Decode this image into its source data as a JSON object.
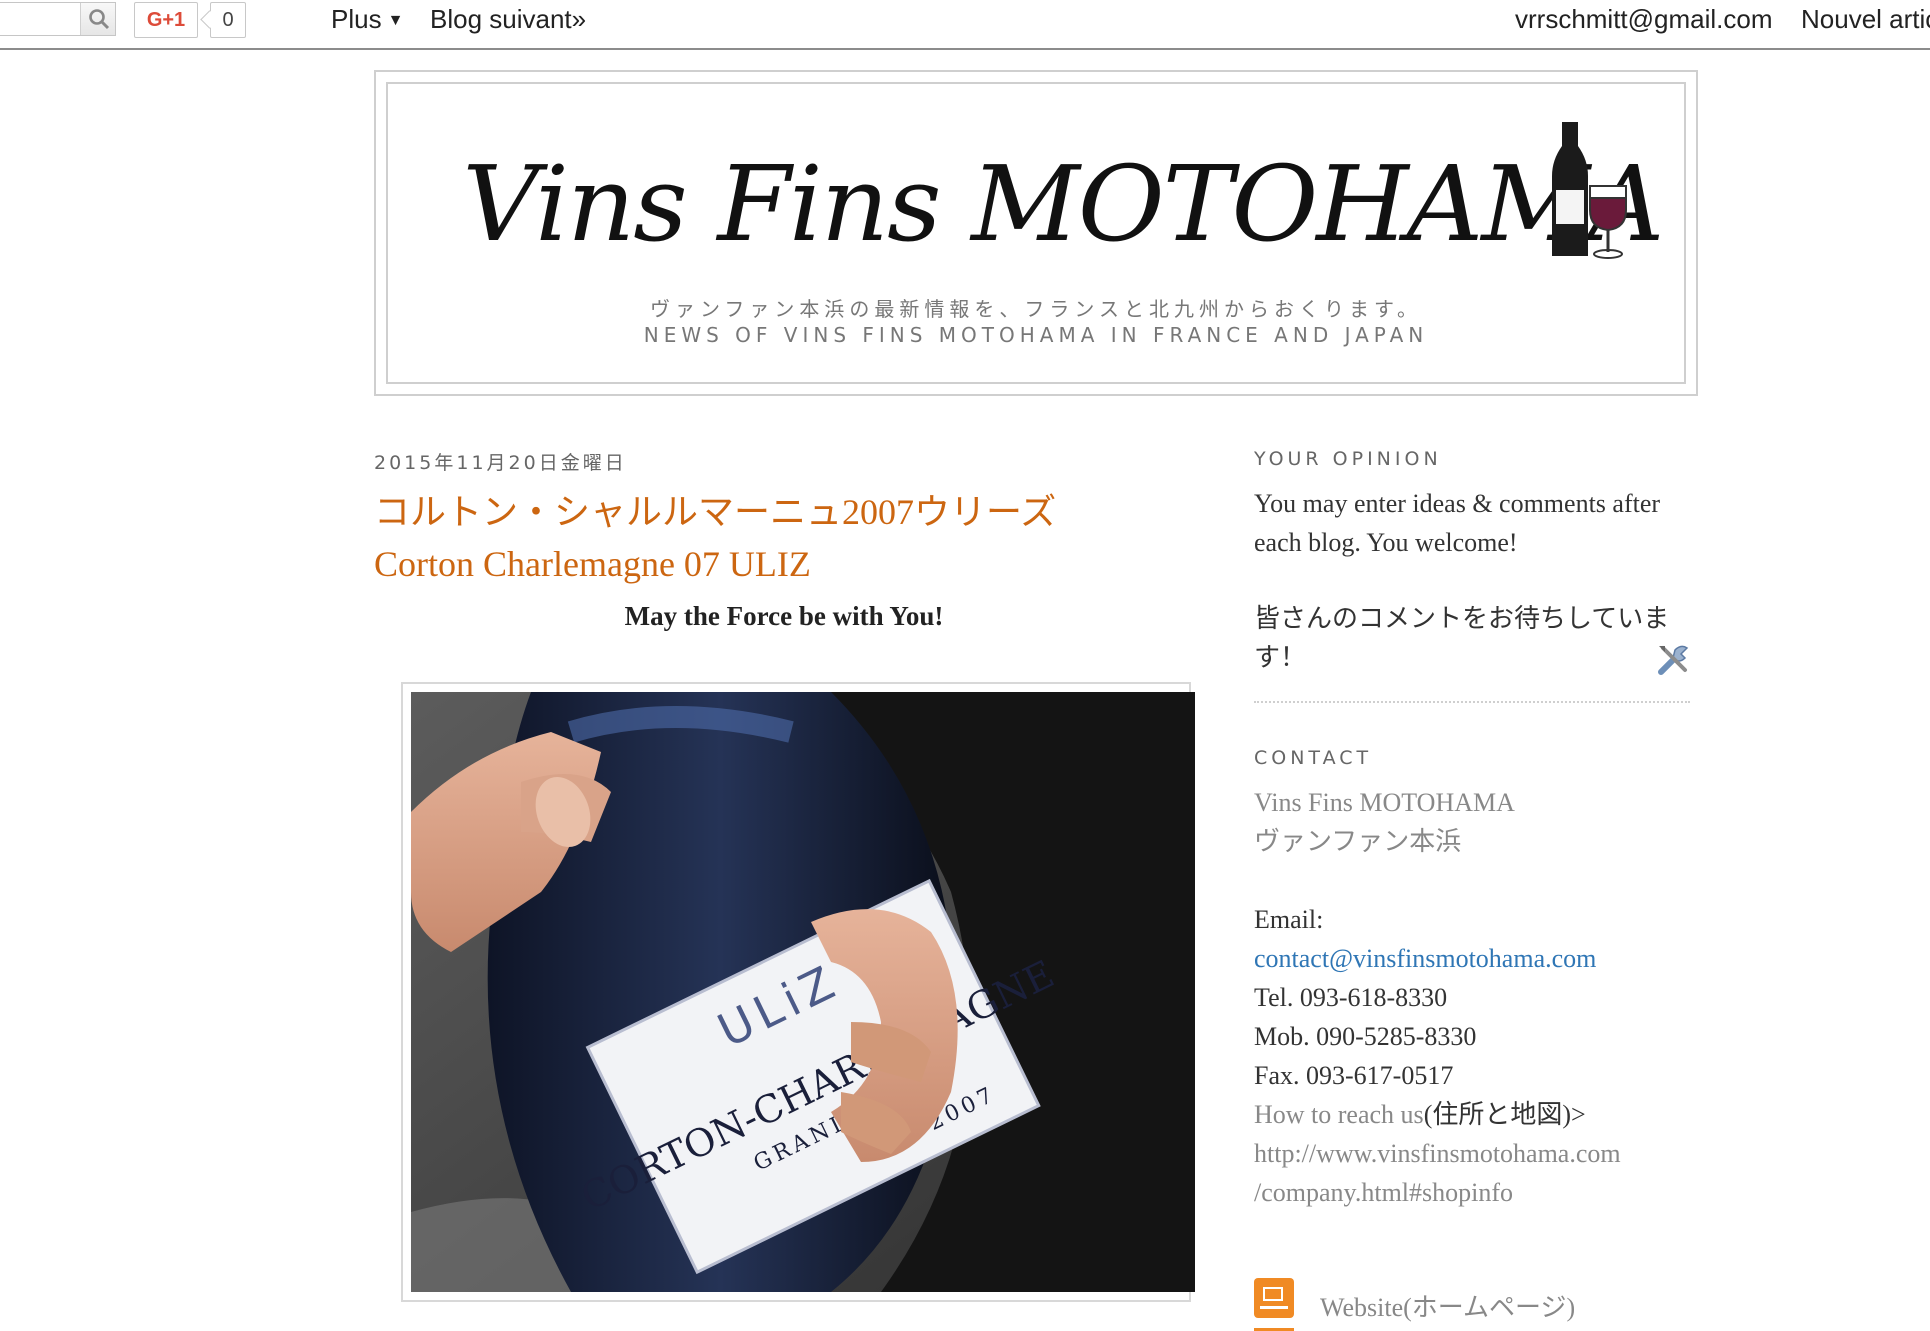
{
  "navbar": {
    "gplus_label": "G+1",
    "gplus_count": "0",
    "more_label": "Plus",
    "next_blog_label": "Blog suivant»",
    "user_email": "vrrschmitt@gmail.com",
    "new_post_label": "Nouvel artic"
  },
  "header": {
    "logo_text": "Vins Fins MOTOHAMA",
    "tagline_jp": "ヴァンファン本浜の最新情報を、フランスと北九州からおくります。",
    "tagline_en": "NEWS OF VINS FINS MOTOHAMA IN FRANCE AND JAPAN"
  },
  "post": {
    "date": "2015年11月20日金曜日",
    "title_line1": "コルトン・シャルルマーニュ2007ウリーズ",
    "title_line2": "Corton Charlemagne 07 ULIZ",
    "tagline": "May the Force be with You!",
    "photo_label_brand": "ULiZ",
    "photo_label_name": "CORTON-CHARLEMAGNE",
    "photo_label_cru": "GRAND CRU",
    "photo_label_year": "2007"
  },
  "sidebar": {
    "opinion_title": "YOUR OPINION",
    "opinion_text_en": "You may enter ideas & comments after each blog. You welcome!",
    "opinion_text_jp": "皆さんのコメントをお待ちしています！",
    "contact_title": "CONTACT",
    "contact_name": "Vins Fins MOTOHAMA",
    "contact_name_jp": "ヴァンファン本浜",
    "email_label": "Email:",
    "email_value": "contact@vinsfinsmotohama.com",
    "tel": "Tel. 093-618-8330",
    "mob": "Mob. 090-5285-8330",
    "fax": "Fax. 093-617-0517",
    "reach_prefix": "How to reach us",
    "reach_suffix": "(住所と地図)>",
    "url_line1": "http://www.vinsfinsmotohama.com",
    "url_line2": "/company.html#shopinfo",
    "website_label": "Website(ホームページ)"
  },
  "colors": {
    "accent": "#cc6611",
    "link": "#2f76b5",
    "feed": "#f08a24"
  }
}
